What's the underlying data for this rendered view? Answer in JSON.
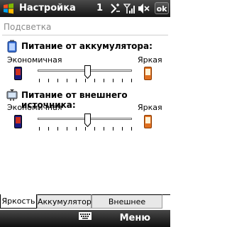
{
  "titlebar": {
    "title": "Настройка",
    "notification_count": "1",
    "ok_label": "ok",
    "icons": [
      "windows-start-icon",
      "connectivity-icon",
      "signal-icon",
      "speaker-muted-icon"
    ]
  },
  "section": {
    "title": "Подсветка"
  },
  "battery": {
    "title": "Питание от аккумулятора:",
    "low_label": "Экономичная",
    "high_label": "Яркая",
    "level": 0.53
  },
  "external": {
    "title": "Питание от внешнего источника:",
    "low_label": "Экономичная",
    "high_label": "Яркая",
    "level": 0.53
  },
  "tabs": [
    {
      "label": "Яркость",
      "active": true
    },
    {
      "label": "Аккумулятор",
      "active": false
    },
    {
      "label": "Внешнее питание",
      "active": false
    }
  ],
  "bottombar": {
    "menu_label": "Меню",
    "keyboard_icon": "keyboard-icon"
  },
  "colors": {
    "titlebar": "#1e1e1e",
    "phone_screen": "#cc3020",
    "phone_body": "#e07020",
    "phone_dark": "#1a1a80"
  }
}
